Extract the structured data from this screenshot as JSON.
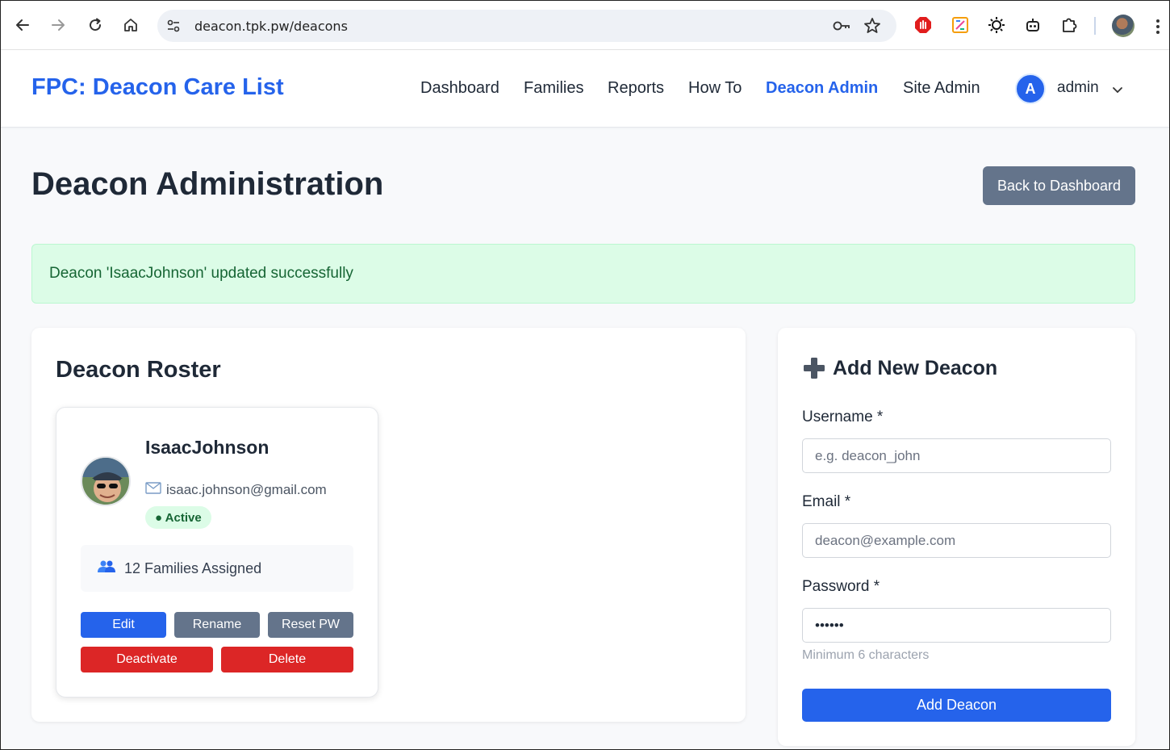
{
  "browser": {
    "url": "deacon.tpk.pw/deacons"
  },
  "header": {
    "brand": "FPC: Deacon Care List",
    "menu": [
      "Dashboard",
      "Families",
      "Reports",
      "How To",
      "Deacon Admin",
      "Site Admin"
    ],
    "active_menu": "Deacon Admin",
    "user_initial": "A",
    "user_name": "admin"
  },
  "page": {
    "title": "Deacon Administration",
    "back_button": "Back to Dashboard"
  },
  "alert": {
    "message": "Deacon 'IsaacJohnson' updated successfully"
  },
  "roster": {
    "title": "Deacon Roster",
    "deacons": [
      {
        "name": "IsaacJohnson",
        "email": "isaac.johnson@gmail.com",
        "status": "● Active",
        "families": "12 Families Assigned",
        "actions": {
          "edit": "Edit",
          "rename": "Rename",
          "reset_pw": "Reset PW",
          "deactivate": "Deactivate",
          "delete": "Delete"
        }
      }
    ]
  },
  "add_form": {
    "title": "Add New Deacon",
    "username_label": "Username *",
    "username_placeholder": "e.g. deacon_john",
    "email_label": "Email *",
    "email_placeholder": "deacon@example.com",
    "password_label": "Password *",
    "password_value": "••••••",
    "password_hint": "Minimum 6 characters",
    "submit": "Add Deacon"
  },
  "colors": {
    "primary": "#2563eb",
    "secondary": "#64748b",
    "danger": "#dc2626",
    "success_bg": "#dcfce7",
    "success_text": "#166534"
  }
}
